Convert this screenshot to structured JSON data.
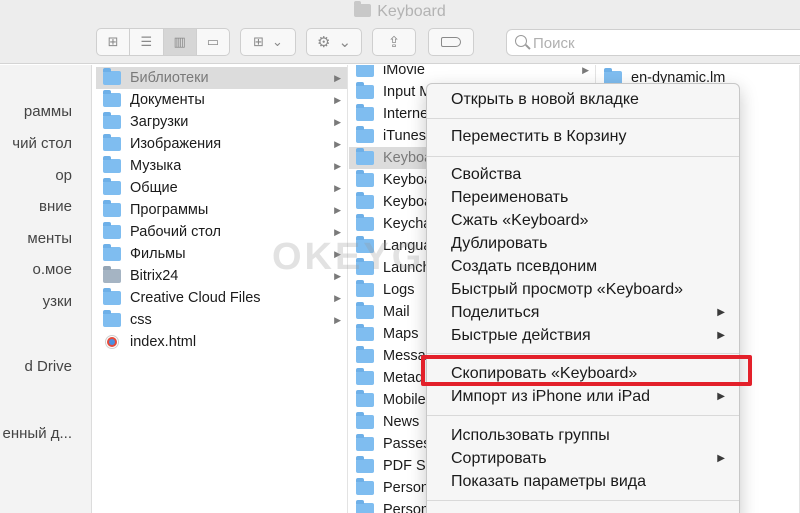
{
  "window": {
    "title": "Keyboard"
  },
  "toolbar": {
    "view_icons": [
      "icon-view-icon",
      "list-view-icon",
      "column-view-icon",
      "gallery-view-icon"
    ],
    "arrange_icon": "arrange-icon",
    "action_icon": "gear-icon",
    "share_icon": "share-icon",
    "tag_icon": "tag-icon"
  },
  "search": {
    "placeholder": "Поиск",
    "value": ""
  },
  "sidebar": {
    "items": [
      {
        "label": "раммы"
      },
      {
        "label": "чий стол"
      },
      {
        "label": "ор"
      },
      {
        "label": "вние"
      },
      {
        "label": "менты"
      },
      {
        "label": "о.мое"
      },
      {
        "label": "узки"
      },
      {
        "label": "d Drive"
      },
      {
        "label": "енный д..."
      }
    ]
  },
  "column1": {
    "rows": [
      {
        "label": "Библиотеки",
        "selected": true
      },
      {
        "label": "Документы"
      },
      {
        "label": "Загрузки"
      },
      {
        "label": "Изображения"
      },
      {
        "label": "Музыка"
      },
      {
        "label": "Общие"
      },
      {
        "label": "Программы"
      },
      {
        "label": "Рабочий стол"
      },
      {
        "label": "Фильмы"
      },
      {
        "label": "Bitrix24"
      },
      {
        "label": "Creative Cloud Files"
      },
      {
        "label": "css"
      },
      {
        "label": "index.html"
      }
    ]
  },
  "column2": {
    "rows": [
      {
        "label": "iMovie"
      },
      {
        "label": "Input M"
      },
      {
        "label": "Interne"
      },
      {
        "label": "iTunes"
      },
      {
        "label": "Keyboa",
        "selected": true
      },
      {
        "label": "Keyboa"
      },
      {
        "label": "Keyboa"
      },
      {
        "label": "Keycha"
      },
      {
        "label": "Langua"
      },
      {
        "label": "Launch"
      },
      {
        "label": "Logs"
      },
      {
        "label": "Mail"
      },
      {
        "label": "Maps"
      },
      {
        "label": "Messa"
      },
      {
        "label": "Metad"
      },
      {
        "label": "Mobile"
      },
      {
        "label": "News"
      },
      {
        "label": "Passes"
      },
      {
        "label": "PDF Se"
      },
      {
        "label": "Person"
      },
      {
        "label": "Person"
      }
    ]
  },
  "column3": {
    "rows": [
      {
        "label": "en-dynamic.lm"
      }
    ]
  },
  "context_menu": {
    "items": [
      {
        "label": "Открыть в новой вкладке"
      },
      {
        "label": "Переместить в Корзину"
      },
      {
        "label": "Свойства"
      },
      {
        "label": "Переименовать"
      },
      {
        "label": "Сжать «Keyboard»"
      },
      {
        "label": "Дублировать"
      },
      {
        "label": "Создать псевдоним"
      },
      {
        "label": "Быстрый просмотр «Keyboard»"
      },
      {
        "label": "Поделиться"
      },
      {
        "label": "Быстрые действия"
      },
      {
        "label": "Скопировать «Keyboard»",
        "highlighted": true
      },
      {
        "label": "Импорт из iPhone или iPad"
      },
      {
        "label": "Использовать группы"
      },
      {
        "label": "Сортировать"
      },
      {
        "label": "Показать параметры вида"
      }
    ]
  },
  "watermark": {
    "text": "OKEYGEEK"
  },
  "colors": {
    "highlight": "#e3202a",
    "folder": "#7fbdf0"
  }
}
